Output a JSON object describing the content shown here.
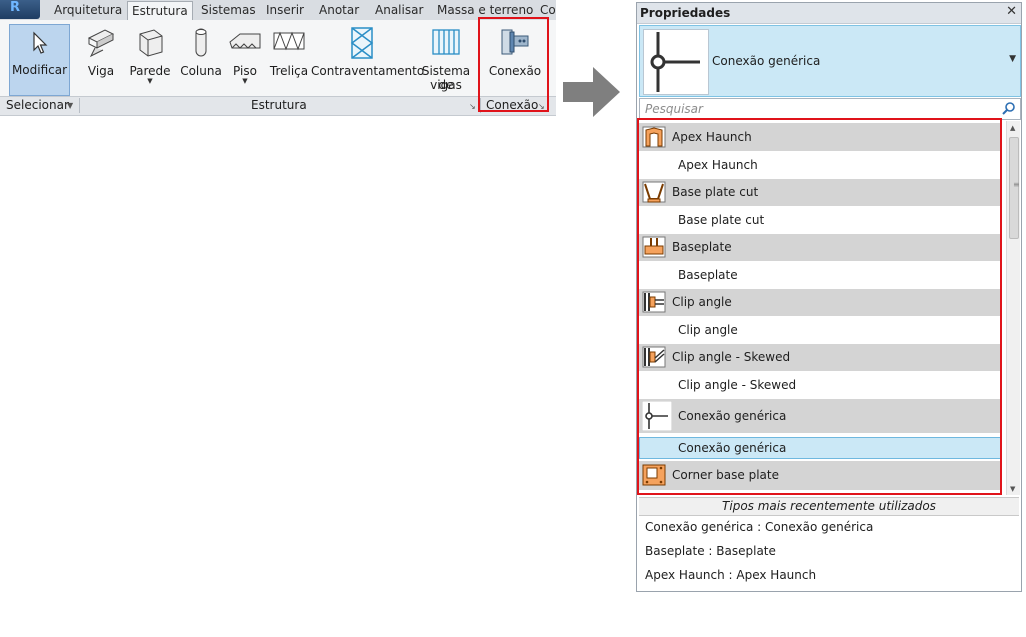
{
  "ribbon": {
    "tabs": [
      "Arquitetura",
      "Estrutura",
      "Sistemas",
      "Inserir",
      "Anotar",
      "Analisar",
      "Massa e terreno",
      "Co"
    ],
    "active_tab": "Estrutura",
    "modify": "Modificar",
    "buttons": {
      "viga": "Viga",
      "parede": "Parede",
      "coluna": "Coluna",
      "piso": "Piso",
      "trelica": "Treliça",
      "contraventamento": "Contraventamento",
      "sistema_vigas_1": "Sistema de",
      "sistema_vigas_2": "vigas",
      "conexao": "Conexão"
    },
    "panels": {
      "selecionar": "Selecionar",
      "estrutura": "Estrutura",
      "conexao": "Conexão"
    }
  },
  "properties": {
    "title": "Propriedades",
    "selected_type": "Conexão genérica",
    "search_placeholder": "Pesquisar",
    "list": [
      {
        "kind": "family",
        "label": "Apex Haunch",
        "icon": "apex-haunch-icon"
      },
      {
        "kind": "type",
        "label": "Apex Haunch"
      },
      {
        "kind": "family",
        "label": "Base plate cut",
        "icon": "base-plate-cut-icon"
      },
      {
        "kind": "type",
        "label": "Base plate cut"
      },
      {
        "kind": "family",
        "label": "Baseplate",
        "icon": "baseplate-icon"
      },
      {
        "kind": "type",
        "label": "Baseplate"
      },
      {
        "kind": "family",
        "label": "Clip angle",
        "icon": "clip-angle-icon"
      },
      {
        "kind": "type",
        "label": "Clip angle"
      },
      {
        "kind": "family",
        "label": "Clip angle - Skewed",
        "icon": "clip-angle-skewed-icon"
      },
      {
        "kind": "type",
        "label": "Clip angle - Skewed"
      },
      {
        "kind": "family",
        "label": "Conexão genérica",
        "icon": "generic-connection-icon"
      },
      {
        "kind": "type",
        "label": "Conexão genérica",
        "selected": true
      },
      {
        "kind": "family",
        "label": "Corner base plate",
        "icon": "corner-base-plate-icon"
      }
    ],
    "recent_header": "Tipos mais recentemente utilizados",
    "recent": [
      "Conexão genérica : Conexão genérica",
      "Baseplate : Baseplate",
      "Apex Haunch : Apex Haunch"
    ]
  },
  "colors": {
    "highlight": "#e0131a",
    "selection": "#cbe8f6",
    "family_row": "#d4d4d4",
    "connection_orange": "#f5a25d"
  }
}
